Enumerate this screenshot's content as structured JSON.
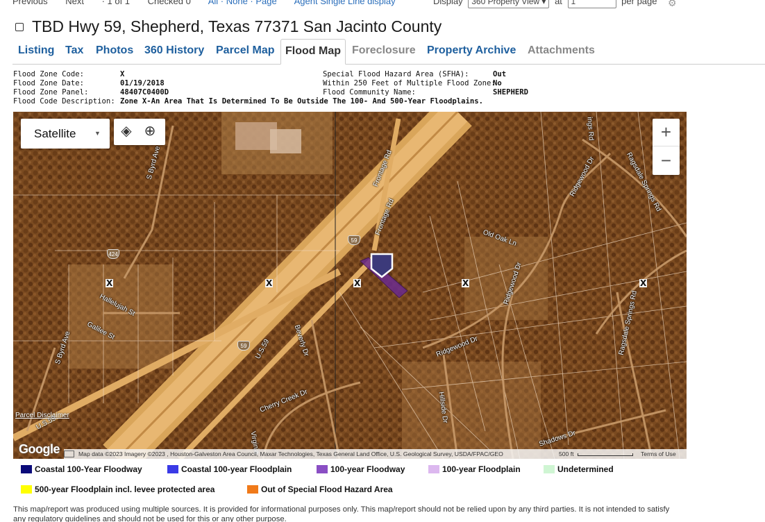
{
  "topbar": {
    "previous": "Previous",
    "next": "Next",
    "count": "· 1 of 1",
    "checked": "Checked 0",
    "select_links": "All · None · Page",
    "display_link": "Agent Single Line display",
    "display_label": "Display",
    "display_value": "360 Property View",
    "at_label": "at",
    "at_value": "1",
    "per_page": "per page"
  },
  "property": {
    "title": "TBD Hwy 59, Shepherd, Texas 77371 San Jacinto County"
  },
  "tabs": [
    {
      "label": "Listing",
      "state": "link"
    },
    {
      "label": "Tax",
      "state": "link"
    },
    {
      "label": "Photos",
      "state": "link"
    },
    {
      "label": "360 History",
      "state": "link"
    },
    {
      "label": "Parcel Map",
      "state": "link"
    },
    {
      "label": "Flood Map",
      "state": "active"
    },
    {
      "label": "Foreclosure",
      "state": "disabled"
    },
    {
      "label": "Property Archive",
      "state": "link"
    },
    {
      "label": "Attachments",
      "state": "disabled"
    }
  ],
  "flood_info": {
    "left": [
      {
        "label": "Flood Zone Code:",
        "value": "X"
      },
      {
        "label": "Flood Zone Date:",
        "value": "01/19/2018"
      },
      {
        "label": "Flood Zone Panel:",
        "value": "48407C0400D"
      },
      {
        "label": "Flood Code Description:",
        "value": "Zone X-An Area That Is Determined To Be Outside The 100- And 500-Year Floodplains."
      }
    ],
    "right": [
      {
        "label": "Special Flood Hazard Area (SFHA):",
        "value": "Out"
      },
      {
        "label": "Within 250 Feet of Multiple Flood Zone:",
        "value": "No"
      },
      {
        "label": "Flood Community Name:",
        "value": "SHEPHERD"
      }
    ]
  },
  "map": {
    "map_type": "Satellite",
    "zoom_in": "+",
    "zoom_out": "−",
    "layers_icon": "layers-icon",
    "locate_icon": "locate-icon",
    "street_labels": [
      "S Byrd Ave",
      "Frontage Rd",
      "Frontage Rd",
      "Ridgewood Dr",
      "Ragsdale Springs Rd",
      "Old Oak Ln",
      "Ridgewood Dr",
      "Hallelujah St",
      "Galilee St",
      "S Byrd Ave",
      "Beverly Dr",
      "U.S.59",
      "Ridgewood Dr",
      "Ragsdale Springs Rd",
      "Cherry Creek Dr",
      "Hillside Dr",
      "Virginia",
      "Shadows Dr",
      "U.S.59",
      "ings Rd"
    ],
    "shields": [
      "424",
      "59",
      "59"
    ],
    "zone_marks": [
      "X",
      "X",
      "X",
      "X",
      "X"
    ],
    "disclaimer": "Parcel Disclaimer",
    "google": "Google",
    "attribution": "Map data ©2023 Imagery ©2023 , Houston-Galveston Area Council, Maxar Technologies, Texas General Land Office, U.S. Geological Survey, USDA/FPAC/GEO",
    "scale": "500 ft",
    "terms": "Terms of Use"
  },
  "legend": [
    {
      "label": "Coastal 100-Year Floodway",
      "color": "#0b0b7a"
    },
    {
      "label": "Coastal 100-year Floodplain",
      "color": "#3a3ae6"
    },
    {
      "label": "100-year Floodway",
      "color": "#8a4fc4"
    },
    {
      "label": "100-year Floodplain",
      "color": "#dcb8ef"
    },
    {
      "label": "Undetermined",
      "color": "#cff5d3"
    },
    {
      "label": "500-year Floodplain incl. levee protected area",
      "color": "#ffff00"
    },
    {
      "label": "Out of Special Flood Hazard Area",
      "color": "#f07a1a"
    }
  ],
  "footer": {
    "text": "This map/report was produced using multiple sources. It is provided for informational purposes only. This map/report should not be relied upon by any third parties. It is not intended to satisfy any regulatory guidelines and should not be used for this or any other purpose."
  }
}
